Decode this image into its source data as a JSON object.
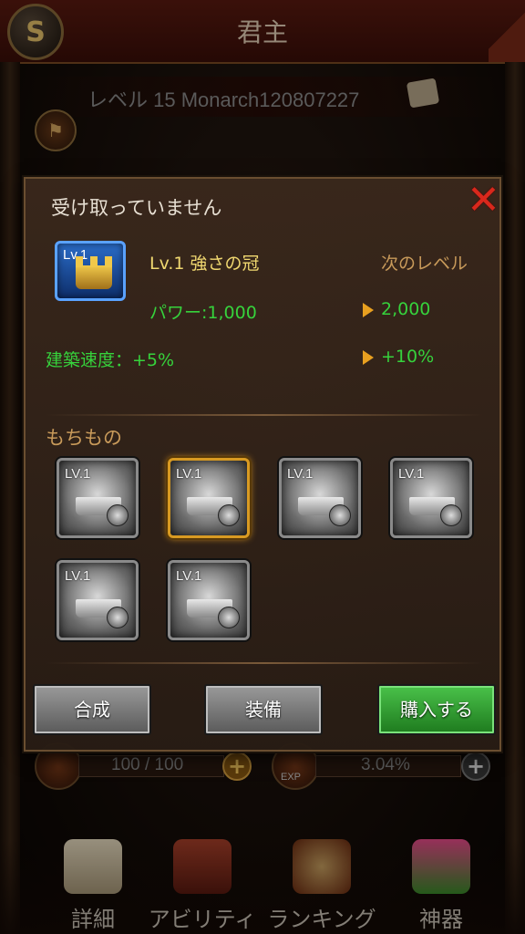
{
  "header": {
    "back_icon": "back-arrow-icon",
    "back_glyph": "S",
    "title": "君主"
  },
  "profile": {
    "level_text": "レベル 15 Monarch120807227",
    "scroll_icon": "scroll-icon",
    "armor_icon": "armor-icon"
  },
  "modal": {
    "title": "受け取っていません",
    "close_label": "✕",
    "item": {
      "level": "Lv.1",
      "name": "Lv.1 強さの冠",
      "next_level_label": "次のレベル",
      "power_label": "パワー:1,000",
      "power_next": "2,000",
      "build_label": "建築速度：+5%",
      "build_next": "+10%"
    },
    "inventory": {
      "title": "もちもの",
      "slots": [
        {
          "level": "LV.1",
          "selected": false
        },
        {
          "level": "LV.1",
          "selected": true
        },
        {
          "level": "LV.1",
          "selected": false
        },
        {
          "level": "LV.1",
          "selected": false
        },
        {
          "level": "LV.1",
          "selected": false
        },
        {
          "level": "LV.1",
          "selected": false
        }
      ]
    },
    "buttons": {
      "combine": "合成",
      "equip": "装備",
      "buy": "購入する"
    }
  },
  "stats": {
    "stamina": "100 / 100",
    "exp": "3.04%",
    "exp_icon_label": "EXP",
    "plus": "+"
  },
  "bottom_nav": {
    "items": [
      {
        "label": "詳細",
        "icon": "scroll-map-icon"
      },
      {
        "label": "アビリティ",
        "icon": "book-icon"
      },
      {
        "label": "ランキング",
        "icon": "sword-shield-icon"
      },
      {
        "label": "神器",
        "icon": "treasure-chest-icon"
      }
    ]
  },
  "colors": {
    "accent_green": "#36d23c",
    "accent_gold": "#f0d870",
    "close_red": "#d8281c"
  }
}
